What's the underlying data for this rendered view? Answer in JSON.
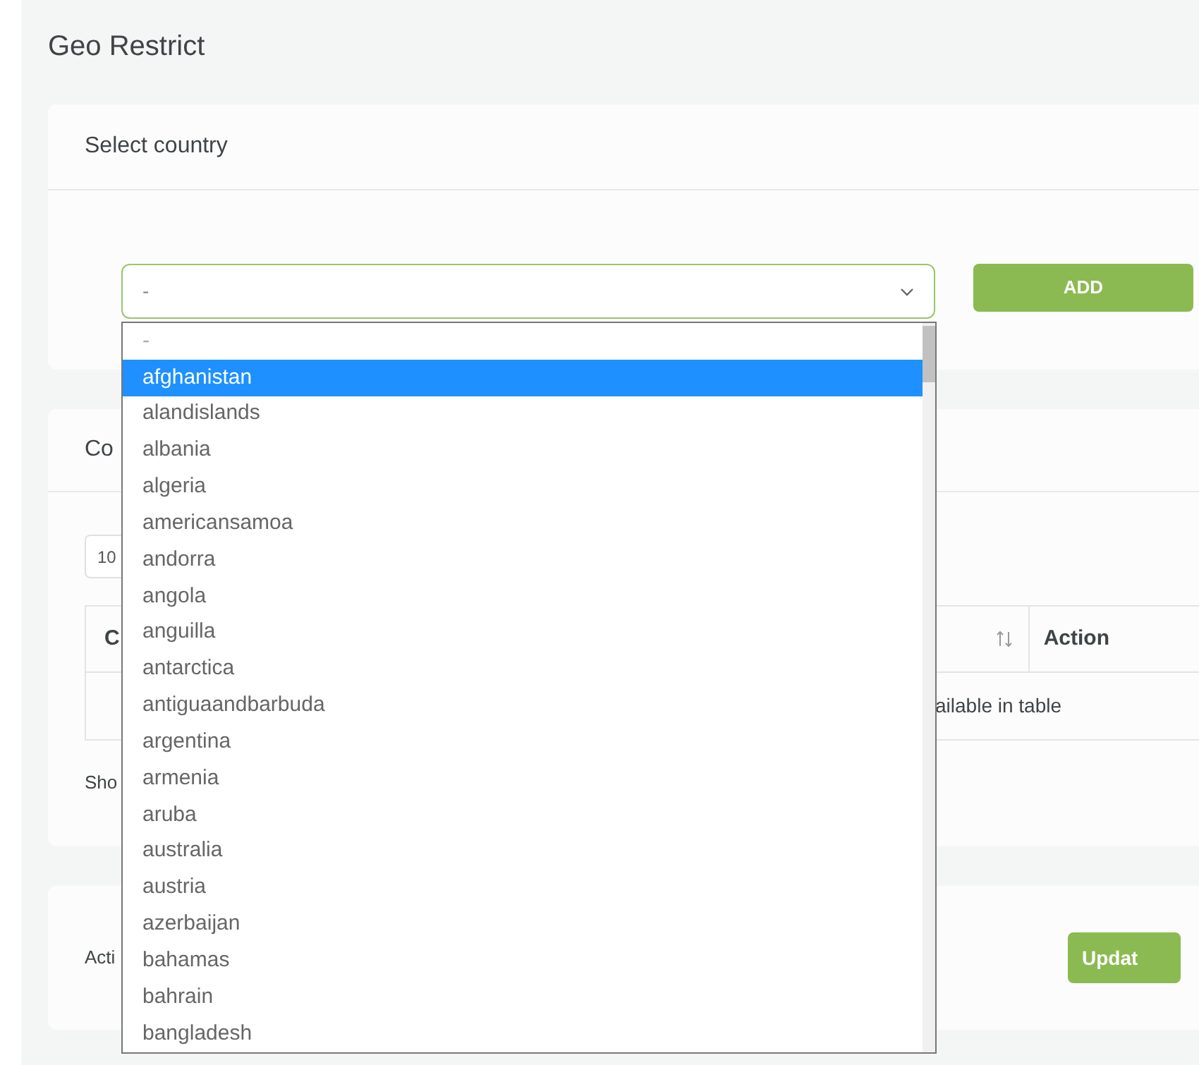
{
  "page_title": "Geo Restrict",
  "select_card": {
    "title": "Select country",
    "select": {
      "value": "-",
      "expanded": true
    },
    "add_button": "ADD"
  },
  "dropdown": {
    "options": [
      {
        "label": "-",
        "selected": false,
        "placeholder": true
      },
      {
        "label": "afghanistan",
        "selected": true
      },
      {
        "label": "alandislands",
        "selected": false
      },
      {
        "label": "albania",
        "selected": false
      },
      {
        "label": "algeria",
        "selected": false
      },
      {
        "label": "americansamoa",
        "selected": false
      },
      {
        "label": "andorra",
        "selected": false
      },
      {
        "label": "angola",
        "selected": false
      },
      {
        "label": "anguilla",
        "selected": false
      },
      {
        "label": "antarctica",
        "selected": false
      },
      {
        "label": "antiguaandbarbuda",
        "selected": false
      },
      {
        "label": "argentina",
        "selected": false
      },
      {
        "label": "armenia",
        "selected": false
      },
      {
        "label": "aruba",
        "selected": false
      },
      {
        "label": "australia",
        "selected": false
      },
      {
        "label": "austria",
        "selected": false
      },
      {
        "label": "azerbaijan",
        "selected": false
      },
      {
        "label": "bahamas",
        "selected": false
      },
      {
        "label": "bahrain",
        "selected": false
      },
      {
        "label": "bangladesh",
        "selected": false
      }
    ]
  },
  "countries_card": {
    "title": "Co",
    "page_size": "10",
    "table": {
      "columns": [
        "C",
        "Action"
      ],
      "empty_text": "ailable in table"
    },
    "footer": "Sho"
  },
  "action_card": {
    "label": "Acti",
    "button": "Updat"
  }
}
